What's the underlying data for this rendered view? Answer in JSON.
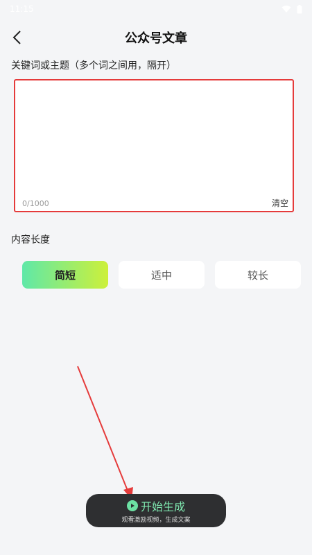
{
  "status_bar": {
    "time": "11:15"
  },
  "header": {
    "title": "公众号文章"
  },
  "keywords": {
    "label": "关键词或主题（多个词之间用，隔开）",
    "value": "",
    "counter": "0/1000",
    "clear_label": "清空"
  },
  "length": {
    "label": "内容长度",
    "options": [
      {
        "label": "简短",
        "selected": true
      },
      {
        "label": "适中",
        "selected": false
      },
      {
        "label": "较长",
        "selected": false
      }
    ]
  },
  "generate": {
    "label": "开始生成",
    "sublabel": "观看激励视频，生成文案"
  },
  "colors": {
    "highlight_border": "#e53b3b",
    "accent_start": "#5fe8a8",
    "accent_end": "#cdf03a",
    "button_bg": "#2e2f31"
  },
  "icons": [
    "back-arrow-icon",
    "wifi-icon",
    "battery-icon",
    "play-icon"
  ]
}
